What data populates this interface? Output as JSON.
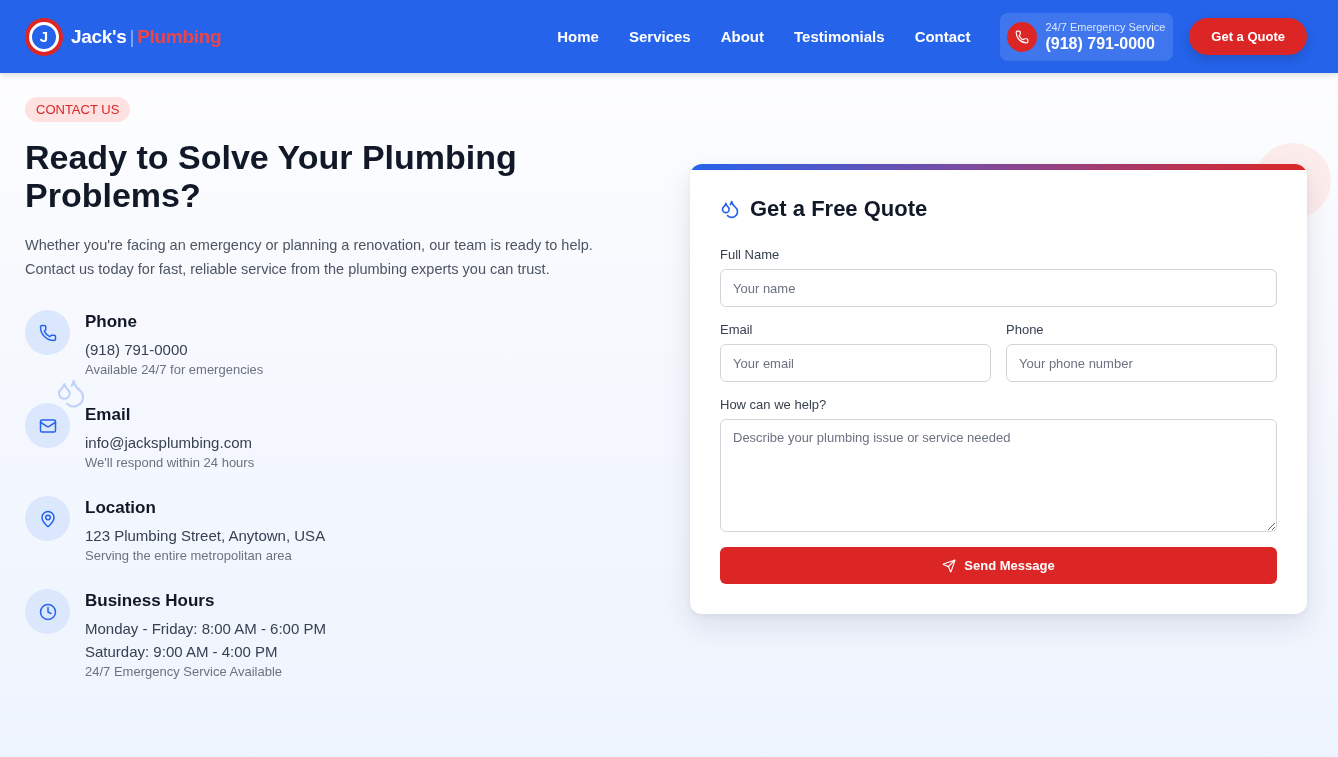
{
  "header": {
    "logo": {
      "letter": "J"
    },
    "brand": {
      "name": "Jack's",
      "separator": "|",
      "trade": "Plumbing"
    },
    "nav": [
      {
        "label": "Home"
      },
      {
        "label": "Services"
      },
      {
        "label": "About"
      },
      {
        "label": "Testimonials"
      },
      {
        "label": "Contact"
      }
    ],
    "emergency": {
      "label": "24/7 Emergency Service",
      "phone": "(918) 791-0000"
    },
    "cta": "Get a Quote"
  },
  "contact": {
    "badge": "CONTACT US",
    "heading": "Ready to Solve Your Plumbing Problems?",
    "intro": "Whether you're facing an emergency or planning a renovation, our team is ready to help. Contact us today for fast, reliable service from the plumbing experts you can trust.",
    "items": [
      {
        "kind": "phone",
        "title": "Phone",
        "lines": [
          "(918) 791-0000"
        ],
        "note": "Available 24/7 for emergencies"
      },
      {
        "kind": "email",
        "title": "Email",
        "lines": [
          "info@jacksplumbing.com"
        ],
        "note": "We'll respond within 24 hours"
      },
      {
        "kind": "location",
        "title": "Location",
        "lines": [
          "123 Plumbing Street, Anytown, USA"
        ],
        "note": "Serving the entire metropolitan area"
      },
      {
        "kind": "hours",
        "title": "Business Hours",
        "lines": [
          "Monday - Friday: 8:00 AM - 6:00 PM",
          "Saturday: 9:00 AM - 4:00 PM"
        ],
        "note": "24/7 Emergency Service Available"
      }
    ]
  },
  "form": {
    "title": "Get a Free Quote",
    "rows": [
      {
        "fields": [
          {
            "kind": "input",
            "label": "Full Name",
            "placeholder": "Your name"
          }
        ]
      },
      {
        "fields": [
          {
            "kind": "input",
            "label": "Email",
            "placeholder": "Your email"
          },
          {
            "kind": "input",
            "label": "Phone",
            "placeholder": "Your phone number"
          }
        ]
      },
      {
        "fields": [
          {
            "kind": "textarea",
            "label": "How can we help?",
            "placeholder": "Describe your plumbing issue or service needed"
          }
        ]
      }
    ],
    "submit": "Send Message"
  }
}
